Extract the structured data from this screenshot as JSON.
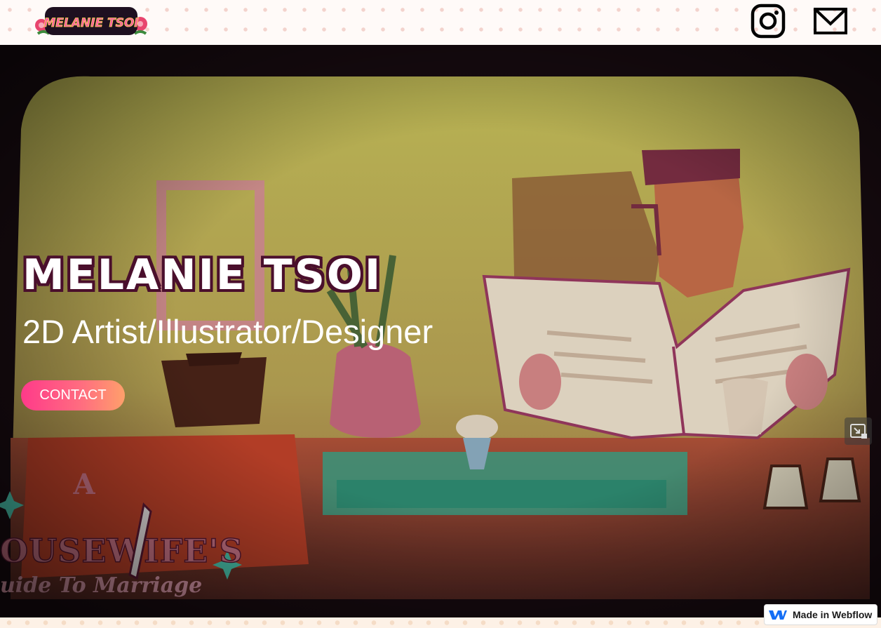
{
  "header": {
    "logo_text": "MELANIE TSOI",
    "instagram_label": "Instagram",
    "email_label": "Email"
  },
  "hero": {
    "title": "MELANIE TSOI",
    "subtitle": "2D Artist/Illustrator/Designer",
    "cta_label": "CONTACT",
    "video_title_line1": "A",
    "video_title_line2": "OUSEWIFE'S",
    "video_title_line3": "uide To Marriage"
  },
  "badge": {
    "label": "Made in Webflow"
  },
  "colors": {
    "title_outline": "#4a0f2c",
    "cta_gradient_start": "#ff3a8a",
    "cta_gradient_end": "#ffa06b"
  }
}
